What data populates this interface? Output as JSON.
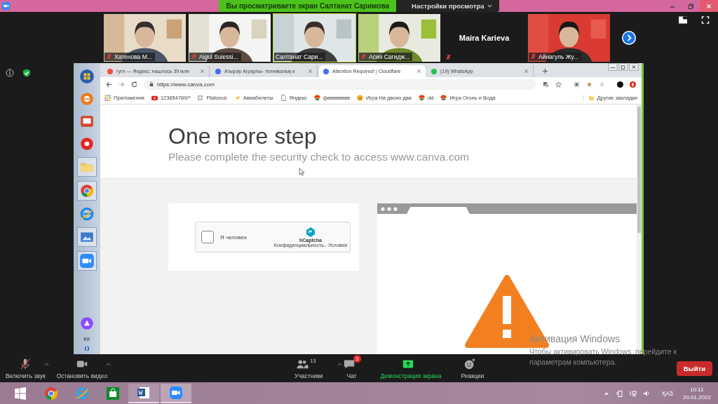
{
  "top_bar": {
    "sharing_banner": "Вы просматриваете экран Салтанат Саримова",
    "view_options": "Настройки просмотра"
  },
  "participants": [
    {
      "name": "Хатенова М...",
      "muted": true,
      "speaking": false,
      "video": true
    },
    {
      "name": "Aigul Suiessi...",
      "muted": true,
      "speaking": false,
      "video": true
    },
    {
      "name": "Салтанат Сари...",
      "muted": false,
      "speaking": true,
      "video": true
    },
    {
      "name": "Асия Сагидж...",
      "muted": true,
      "speaking": false,
      "video": true
    },
    {
      "name": "Maira Karieva",
      "muted": true,
      "speaking": false,
      "video": false
    },
    {
      "name": "Айнагуль Жу...",
      "muted": true,
      "speaking": false,
      "video": true
    }
  ],
  "shared_screen": {
    "side_taskbar": {
      "language": "KK"
    },
    "browser": {
      "tabs": [
        {
          "title": "гугл — Яндекс: нашлось 39 млн",
          "kind": "yandex",
          "selected": false
        },
        {
          "title": "Атырау Аграрлы- техникалық к",
          "kind": "canva",
          "selected": false
        },
        {
          "title": "Attention Required! | Cloudflare",
          "kind": "canva",
          "selected": true
        },
        {
          "title": "(19) WhatsApp",
          "kind": "whatsapp",
          "selected": false
        }
      ],
      "address": "https://www.canva.com",
      "bookmarks": [
        {
          "label": "Приложения",
          "kind": "apps"
        },
        {
          "label": "123654789/*",
          "kind": "youtube"
        },
        {
          "label": "Platonus",
          "kind": "grey"
        },
        {
          "label": "Авиабилеты",
          "kind": "plane"
        },
        {
          "label": "Яндекс",
          "kind": "page"
        },
        {
          "label": "фвввввввв",
          "kind": "ball"
        },
        {
          "label": "Игра На двоих два",
          "kind": "smiley"
        },
        {
          "label": "dd",
          "kind": "ball"
        },
        {
          "label": "Игра Огонь и Вода",
          "kind": "ball"
        }
      ],
      "other_bookmarks": "Другие закладки",
      "page": {
        "heading": "One more step",
        "subtitle": "Please complete the security check to access www.canva.com",
        "captcha": {
          "label": "Я человек",
          "checked": false,
          "brand": "hCaptcha",
          "links": "Конфиденциальность - Условия"
        }
      }
    }
  },
  "activation_notice": {
    "title": "Активация Windows",
    "text": "Чтобы активировать Windows, перейдите к параметрам компьютера."
  },
  "toolbar": {
    "items": [
      {
        "kind": "mic",
        "label": "Включить звук",
        "muted": true
      },
      {
        "kind": "video",
        "label": "Остановить видео"
      },
      {
        "kind": "participants",
        "label": "Участники",
        "count": "13"
      },
      {
        "kind": "chat",
        "label": "Чат",
        "badge": "3"
      },
      {
        "kind": "share",
        "label": "Демонстрация экрана"
      },
      {
        "kind": "reactions",
        "label": "Реакции"
      }
    ],
    "leave": "Выйти"
  },
  "taskbar": {
    "language": "ҚАЗ",
    "time": "10:11",
    "date": "20.01.2022"
  }
}
